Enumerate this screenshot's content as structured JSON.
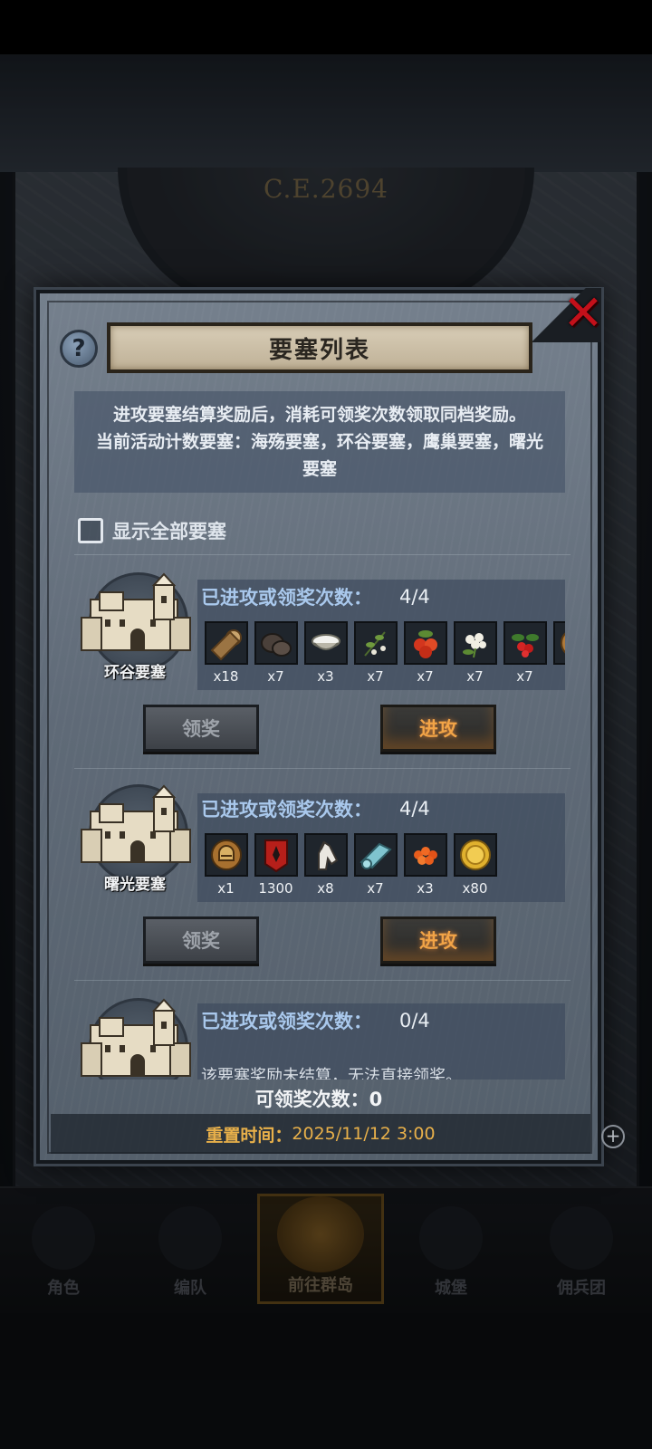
{
  "background": {
    "year": "C.E.2694"
  },
  "dialog": {
    "title": "要塞列表",
    "close_icon": "close-x-icon",
    "help_label": "?",
    "description": [
      "进攻要塞结算奖励后，消耗可领奖次数领取同档奖励。",
      "当前活动计数要塞：海殇要塞，环谷要塞，鹰巢要塞，曙光",
      "要塞"
    ],
    "show_all_label": "显示全部要塞",
    "show_all_checked": false,
    "count_label": "已进攻或领奖次数：",
    "claim_label": "领奖",
    "attack_label": "进攻",
    "fortresses": [
      {
        "name": "环谷要塞",
        "count": "4/4",
        "rewards": [
          {
            "icon": "wood-log-icon",
            "qty": "x18"
          },
          {
            "icon": "truffle-icon",
            "qty": "x7"
          },
          {
            "icon": "salt-bowl-icon",
            "qty": "x3"
          },
          {
            "icon": "herb-sprig-icon",
            "qty": "x7"
          },
          {
            "icon": "red-berries-icon",
            "qty": "x7"
          },
          {
            "icon": "white-flower-icon",
            "qty": "x7"
          },
          {
            "icon": "holly-berries-icon",
            "qty": "x7"
          },
          {
            "icon": "bronze-coin-icon",
            "qty": "x"
          }
        ]
      },
      {
        "name": "曙光要塞",
        "count": "4/4",
        "rewards": [
          {
            "icon": "knight-helmet-icon",
            "qty": "x1"
          },
          {
            "icon": "red-banner-icon",
            "qty": "1300"
          },
          {
            "icon": "horse-head-icon",
            "qty": "x8"
          },
          {
            "icon": "cloth-roll-icon",
            "qty": "x7"
          },
          {
            "icon": "orange-roe-icon",
            "qty": "x3"
          },
          {
            "icon": "gold-coin-icon",
            "qty": "x80"
          }
        ]
      },
      {
        "name": "",
        "count": "0/4",
        "notice": "该要塞奖励未结算，无法直接领奖。"
      }
    ],
    "claimable_text": "可领奖次数：0",
    "reset_label": "重置时间：",
    "reset_value": "2025/11/12 3:00"
  },
  "nav": {
    "items": [
      {
        "label": "角色",
        "icon": "knight-icon"
      },
      {
        "label": "编队",
        "icon": "helmet-icon"
      },
      {
        "label": "前往群岛",
        "icon": "compass-icon",
        "active": true
      },
      {
        "label": "城堡",
        "icon": "castle-icon"
      },
      {
        "label": "佣兵团",
        "icon": "mercenary-icon"
      }
    ]
  },
  "colors": {
    "accent_orange": "#f2a447",
    "count_label_blue": "#a9c8ec",
    "close_red": "#c3101a",
    "reset_gold": "#e8b04a"
  }
}
